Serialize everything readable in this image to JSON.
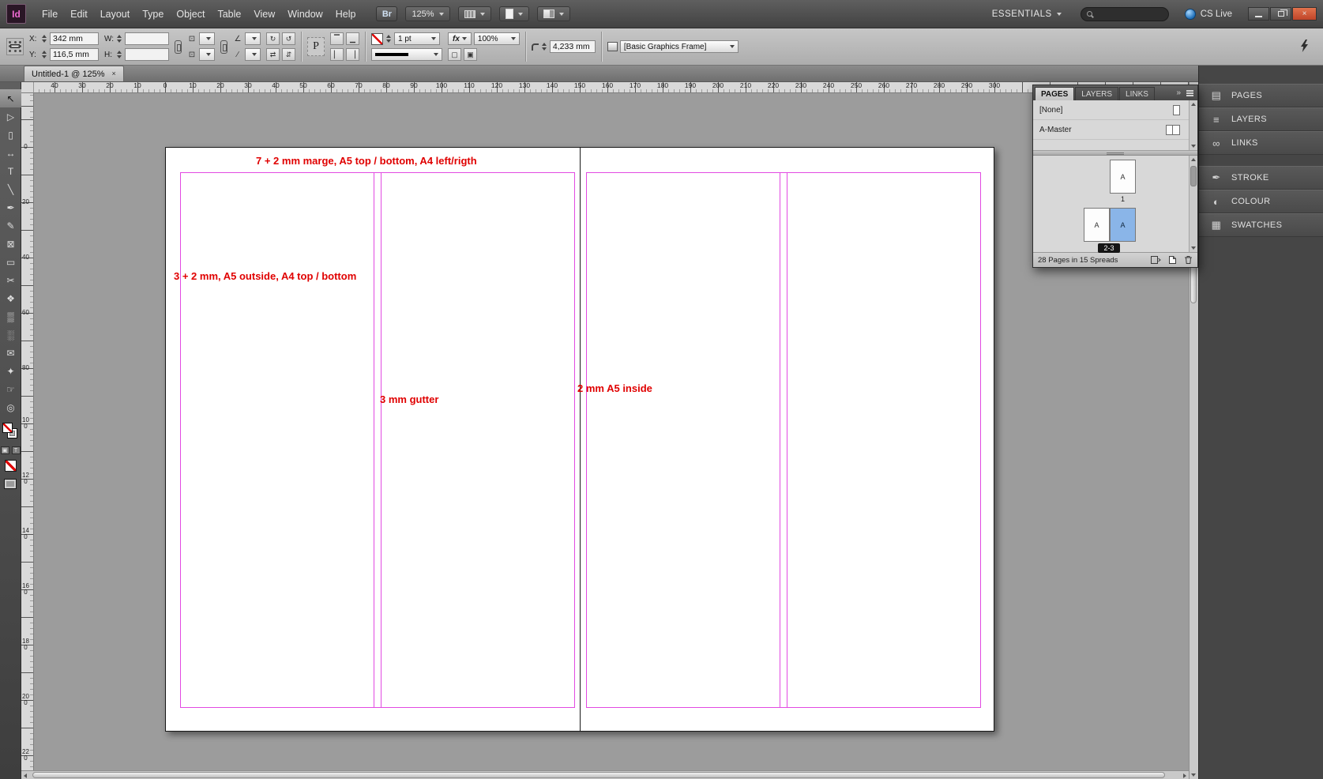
{
  "colors": {
    "guide_magenta": "#e24ae2",
    "annotation_red": "#e00000",
    "selected_page_blue": "#8ab5e8",
    "close_button_red": "#bf4428"
  },
  "titlebar": {
    "app_logo": "Id",
    "menus": [
      {
        "name": "menu-file",
        "label": "File"
      },
      {
        "name": "menu-edit",
        "label": "Edit"
      },
      {
        "name": "menu-layout",
        "label": "Layout"
      },
      {
        "name": "menu-type",
        "label": "Type"
      },
      {
        "name": "menu-object",
        "label": "Object"
      },
      {
        "name": "menu-table",
        "label": "Table"
      },
      {
        "name": "menu-view",
        "label": "View"
      },
      {
        "name": "menu-window",
        "label": "Window"
      },
      {
        "name": "menu-help",
        "label": "Help"
      }
    ],
    "bridge_label": "Br",
    "zoom_value": "125%",
    "workspace": "ESSENTIALS",
    "cs_live": "CS Live",
    "close_glyph": "×"
  },
  "control_panel": {
    "x_label": "X:",
    "x_value": "342 mm",
    "y_label": "Y:",
    "y_value": "116,5 mm",
    "w_label": "W:",
    "w_value": "",
    "h_label": "H:",
    "h_value": "",
    "scale_x_value": "",
    "scale_y_value": "",
    "rotation_value": "",
    "shear_value": "",
    "stroke_weight": "1 pt",
    "fx_label": "fx",
    "opacity": "100%",
    "corner_radius": "4,233 mm",
    "object_style": "[Basic Graphics Frame]"
  },
  "icons": {
    "scale_x": "⊡",
    "scale_y": "⊡",
    "rotation": "∠",
    "shear": "∕",
    "rotate_cw": "↻",
    "rotate_ccw": "↺",
    "flip_h": "⇄",
    "flip_v": "⇵",
    "align_top": "▔",
    "align_bottom": "▁",
    "align_left": "▏",
    "align_right": "▕",
    "wrap_none": "▢",
    "wrap_around": "▣",
    "p_frame": "P",
    "collapse": "»"
  },
  "document_tab": {
    "title": "Untitled-1 @ 125%",
    "close_glyph": "×"
  },
  "rulers": {
    "horizontal": [
      "40",
      "30",
      "20",
      "10",
      "0",
      "10",
      "20",
      "30",
      "40",
      "50",
      "60",
      "70",
      "80",
      "90",
      "100",
      "110",
      "120",
      "130",
      "140",
      "150",
      "160",
      "170",
      "180",
      "190",
      "200",
      "210",
      "220",
      "230",
      "240",
      "250",
      "260",
      "270",
      "280",
      "290",
      "300"
    ],
    "vertical": [
      "20",
      "0",
      "20",
      "40",
      "60",
      "80",
      "100",
      "120",
      "140",
      "160",
      "180",
      "200",
      "220"
    ]
  },
  "tools": [
    {
      "name": "selection-tool",
      "glyph": "↖",
      "selected": true
    },
    {
      "name": "direct-selection-tool",
      "glyph": "▷"
    },
    {
      "name": "page-tool",
      "glyph": "▯"
    },
    {
      "name": "gap-tool",
      "glyph": "↔"
    },
    {
      "name": "type-tool",
      "glyph": "T"
    },
    {
      "name": "line-tool",
      "glyph": "╲"
    },
    {
      "name": "pen-tool",
      "glyph": "✒"
    },
    {
      "name": "pencil-tool",
      "glyph": "✎"
    },
    {
      "name": "rectangle-frame-tool",
      "glyph": "⊠"
    },
    {
      "name": "rectangle-tool",
      "glyph": "▭"
    },
    {
      "name": "scissors-tool",
      "glyph": "✂"
    },
    {
      "name": "free-transform-tool",
      "glyph": "❖"
    },
    {
      "name": "gradient-swatch-tool",
      "glyph": "▒"
    },
    {
      "name": "gradient-feather-tool",
      "glyph": "░"
    },
    {
      "name": "note-tool",
      "glyph": "✉"
    },
    {
      "name": "eyedropper-tool",
      "glyph": "✦"
    },
    {
      "name": "hand-tool",
      "glyph": "☞"
    },
    {
      "name": "zoom-tool",
      "glyph": "◎"
    }
  ],
  "annotations": [
    "7 + 2 mm marge, A5 top / bottom, A4 left/rigth",
    "3 + 2 mm, A5 outside, A4 top / bottom",
    "3 mm gutter",
    "2 mm A5 inside"
  ],
  "pages_panel": {
    "tabs": [
      {
        "name": "tab-pages",
        "label": "PAGES",
        "active": true
      },
      {
        "name": "tab-layers",
        "label": "LAYERS"
      },
      {
        "name": "tab-links",
        "label": "LINKS"
      }
    ],
    "masters": {
      "none_label": "[None]",
      "a_master_label": "A-Master"
    },
    "master_prefix": "A",
    "page1_label": "1",
    "spread_label": "2-3",
    "status": "28 Pages in 15 Spreads"
  },
  "dock": {
    "group1": [
      {
        "name": "dock-pages",
        "label": "PAGES",
        "glyph": "▤"
      },
      {
        "name": "dock-layers",
        "label": "LAYERS",
        "glyph": "≡"
      },
      {
        "name": "dock-links",
        "label": "LINKS",
        "glyph": "∞"
      }
    ],
    "group2": [
      {
        "name": "dock-stroke",
        "label": "STROKE",
        "glyph": "✒"
      },
      {
        "name": "dock-colour",
        "label": "COLOUR",
        "glyph": "◐"
      },
      {
        "name": "dock-swatches",
        "label": "SWATCHES",
        "glyph": "▦"
      }
    ]
  }
}
